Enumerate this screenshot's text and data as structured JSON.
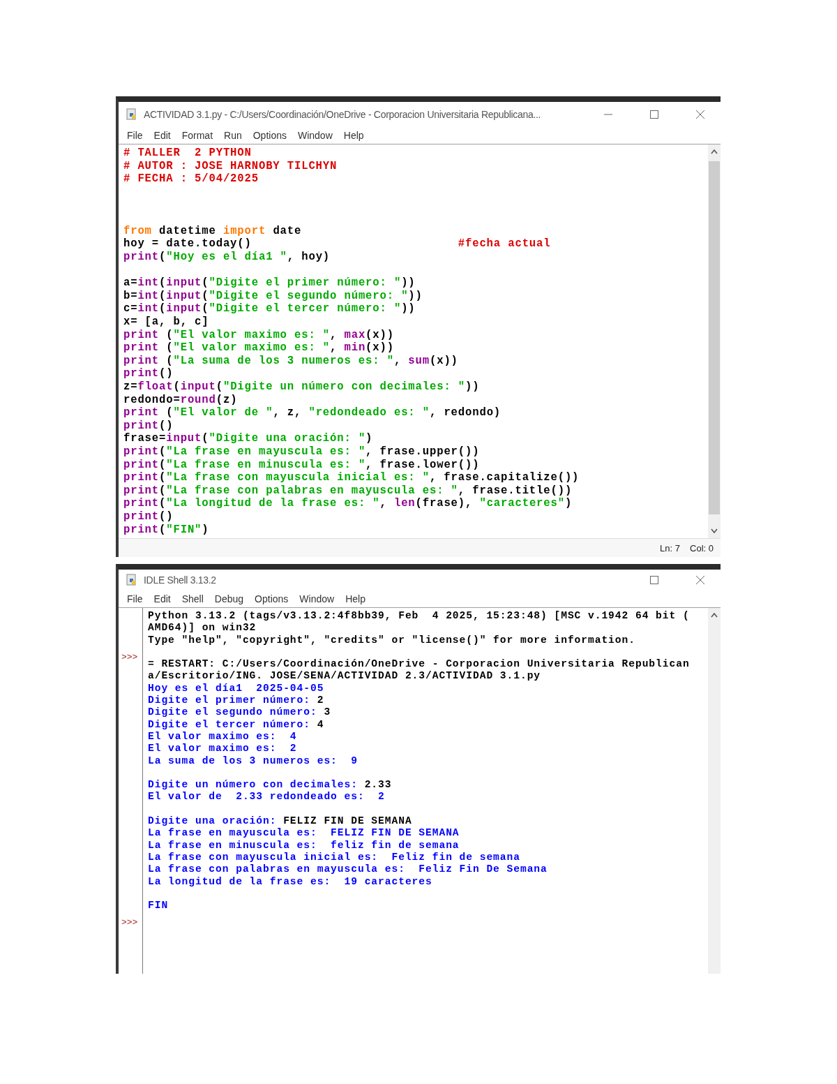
{
  "editor": {
    "title": "ACTIVIDAD 3.1.py - C:/Users/Coordinación/OneDrive - Corporacion Universitaria Republicana...",
    "menu": [
      "File",
      "Edit",
      "Format",
      "Run",
      "Options",
      "Window",
      "Help"
    ],
    "lines": [
      {
        "kind": "code",
        "segments": [
          {
            "text": "# TALLER  2 PYTHON",
            "kind": "comment"
          }
        ]
      },
      {
        "kind": "code",
        "segments": [
          {
            "text": "# AUTOR : JOSE HARNOBY TILCHYN",
            "kind": "comment"
          }
        ]
      },
      {
        "kind": "code",
        "segments": [
          {
            "text": "# FECHA : 5/04/2025",
            "kind": "comment"
          }
        ]
      },
      {
        "kind": "blank"
      },
      {
        "kind": "blank"
      },
      {
        "kind": "blank"
      },
      {
        "kind": "code",
        "segments": [
          {
            "text": "from",
            "kind": "keyword"
          },
          {
            "text": " datetime ",
            "kind": "plain"
          },
          {
            "text": "import",
            "kind": "keyword"
          },
          {
            "text": " date",
            "kind": "plain"
          }
        ]
      },
      {
        "kind": "code",
        "segments": [
          {
            "text": "hoy = date.today()                             ",
            "kind": "plain"
          },
          {
            "text": "#fecha actual",
            "kind": "comment"
          }
        ]
      },
      {
        "kind": "code",
        "segments": [
          {
            "text": "print",
            "kind": "builtin"
          },
          {
            "text": "(",
            "kind": "plain"
          },
          {
            "text": "\"Hoy es el día1 \"",
            "kind": "string"
          },
          {
            "text": ", hoy)",
            "kind": "plain"
          }
        ]
      },
      {
        "kind": "blank"
      },
      {
        "kind": "code",
        "segments": [
          {
            "text": "a=",
            "kind": "plain"
          },
          {
            "text": "int",
            "kind": "builtin"
          },
          {
            "text": "(",
            "kind": "plain"
          },
          {
            "text": "input",
            "kind": "builtin"
          },
          {
            "text": "(",
            "kind": "plain"
          },
          {
            "text": "\"Digite el primer número: \"",
            "kind": "string"
          },
          {
            "text": "))",
            "kind": "plain"
          }
        ]
      },
      {
        "kind": "code",
        "segments": [
          {
            "text": "b=",
            "kind": "plain"
          },
          {
            "text": "int",
            "kind": "builtin"
          },
          {
            "text": "(",
            "kind": "plain"
          },
          {
            "text": "input",
            "kind": "builtin"
          },
          {
            "text": "(",
            "kind": "plain"
          },
          {
            "text": "\"Digite el segundo número: \"",
            "kind": "string"
          },
          {
            "text": "))",
            "kind": "plain"
          }
        ]
      },
      {
        "kind": "code",
        "segments": [
          {
            "text": "c=",
            "kind": "plain"
          },
          {
            "text": "int",
            "kind": "builtin"
          },
          {
            "text": "(",
            "kind": "plain"
          },
          {
            "text": "input",
            "kind": "builtin"
          },
          {
            "text": "(",
            "kind": "plain"
          },
          {
            "text": "\"Digite el tercer número: \"",
            "kind": "string"
          },
          {
            "text": "))",
            "kind": "plain"
          }
        ]
      },
      {
        "kind": "code",
        "segments": [
          {
            "text": "x= [a, b, c]",
            "kind": "plain"
          }
        ]
      },
      {
        "kind": "code",
        "segments": [
          {
            "text": "print",
            "kind": "builtin"
          },
          {
            "text": " (",
            "kind": "plain"
          },
          {
            "text": "\"El valor maximo es: \"",
            "kind": "string"
          },
          {
            "text": ", ",
            "kind": "plain"
          },
          {
            "text": "max",
            "kind": "builtin"
          },
          {
            "text": "(x))",
            "kind": "plain"
          }
        ]
      },
      {
        "kind": "code",
        "segments": [
          {
            "text": "print",
            "kind": "builtin"
          },
          {
            "text": " (",
            "kind": "plain"
          },
          {
            "text": "\"El valor maximo es: \"",
            "kind": "string"
          },
          {
            "text": ", ",
            "kind": "plain"
          },
          {
            "text": "min",
            "kind": "builtin"
          },
          {
            "text": "(x))",
            "kind": "plain"
          }
        ]
      },
      {
        "kind": "code",
        "segments": [
          {
            "text": "print",
            "kind": "builtin"
          },
          {
            "text": " (",
            "kind": "plain"
          },
          {
            "text": "\"La suma de los 3 numeros es: \"",
            "kind": "string"
          },
          {
            "text": ", ",
            "kind": "plain"
          },
          {
            "text": "sum",
            "kind": "builtin"
          },
          {
            "text": "(x))",
            "kind": "plain"
          }
        ]
      },
      {
        "kind": "code",
        "segments": [
          {
            "text": "print",
            "kind": "builtin"
          },
          {
            "text": "()",
            "kind": "plain"
          }
        ]
      },
      {
        "kind": "code",
        "segments": [
          {
            "text": "z=",
            "kind": "plain"
          },
          {
            "text": "float",
            "kind": "builtin"
          },
          {
            "text": "(",
            "kind": "plain"
          },
          {
            "text": "input",
            "kind": "builtin"
          },
          {
            "text": "(",
            "kind": "plain"
          },
          {
            "text": "\"Digite un número con decimales: \"",
            "kind": "string"
          },
          {
            "text": "))",
            "kind": "plain"
          }
        ]
      },
      {
        "kind": "code",
        "segments": [
          {
            "text": "redondo=",
            "kind": "plain"
          },
          {
            "text": "round",
            "kind": "builtin"
          },
          {
            "text": "(z)",
            "kind": "plain"
          }
        ]
      },
      {
        "kind": "code",
        "segments": [
          {
            "text": "print",
            "kind": "builtin"
          },
          {
            "text": " (",
            "kind": "plain"
          },
          {
            "text": "\"El valor de \"",
            "kind": "string"
          },
          {
            "text": ", z, ",
            "kind": "plain"
          },
          {
            "text": "\"redondeado es: \"",
            "kind": "string"
          },
          {
            "text": ", redondo)",
            "kind": "plain"
          }
        ]
      },
      {
        "kind": "code",
        "segments": [
          {
            "text": "print",
            "kind": "builtin"
          },
          {
            "text": "()",
            "kind": "plain"
          }
        ]
      },
      {
        "kind": "code",
        "segments": [
          {
            "text": "frase=",
            "kind": "plain"
          },
          {
            "text": "input",
            "kind": "builtin"
          },
          {
            "text": "(",
            "kind": "plain"
          },
          {
            "text": "\"Digite una oración: \"",
            "kind": "string"
          },
          {
            "text": ")",
            "kind": "plain"
          }
        ]
      },
      {
        "kind": "code",
        "segments": [
          {
            "text": "print",
            "kind": "builtin"
          },
          {
            "text": "(",
            "kind": "plain"
          },
          {
            "text": "\"La frase en mayuscula es: \"",
            "kind": "string"
          },
          {
            "text": ", frase.upper())",
            "kind": "plain"
          }
        ]
      },
      {
        "kind": "code",
        "segments": [
          {
            "text": "print",
            "kind": "builtin"
          },
          {
            "text": "(",
            "kind": "plain"
          },
          {
            "text": "\"La frase en minuscula es: \"",
            "kind": "string"
          },
          {
            "text": ", frase.lower())",
            "kind": "plain"
          }
        ]
      },
      {
        "kind": "code",
        "segments": [
          {
            "text": "print",
            "kind": "builtin"
          },
          {
            "text": "(",
            "kind": "plain"
          },
          {
            "text": "\"La frase con mayuscula inicial es: \"",
            "kind": "string"
          },
          {
            "text": ", frase.capitalize())",
            "kind": "plain"
          }
        ]
      },
      {
        "kind": "code",
        "segments": [
          {
            "text": "print",
            "kind": "builtin"
          },
          {
            "text": "(",
            "kind": "plain"
          },
          {
            "text": "\"La frase con palabras en mayuscula es: \"",
            "kind": "string"
          },
          {
            "text": ", frase.title())",
            "kind": "plain"
          }
        ]
      },
      {
        "kind": "code",
        "segments": [
          {
            "text": "print",
            "kind": "builtin"
          },
          {
            "text": "(",
            "kind": "plain"
          },
          {
            "text": "\"La longitud de la frase es: \"",
            "kind": "string"
          },
          {
            "text": ", ",
            "kind": "plain"
          },
          {
            "text": "len",
            "kind": "builtin"
          },
          {
            "text": "(frase), ",
            "kind": "plain"
          },
          {
            "text": "\"caracteres\"",
            "kind": "string"
          },
          {
            "text": ")",
            "kind": "plain"
          }
        ]
      },
      {
        "kind": "code",
        "segments": [
          {
            "text": "print",
            "kind": "builtin"
          },
          {
            "text": "()",
            "kind": "plain"
          }
        ]
      },
      {
        "kind": "code",
        "segments": [
          {
            "text": "print",
            "kind": "builtin"
          },
          {
            "text": "(",
            "kind": "plain"
          },
          {
            "text": "\"FIN\"",
            "kind": "string"
          },
          {
            "text": ")",
            "kind": "plain"
          }
        ]
      }
    ],
    "status": {
      "line": "Ln: 7",
      "column": "Col: 0"
    }
  },
  "shell": {
    "title": "IDLE Shell 3.13.2",
    "menu": [
      "File",
      "Edit",
      "Shell",
      "Debug",
      "Options",
      "Window",
      "Help"
    ],
    "lines": [
      {
        "kind": "code",
        "segments": [
          {
            "text": "Python 3.13.2 (tags/v3.13.2:4f8bb39, Feb  4 2025, 15:23:48) [MSC v.1942 64 bit (",
            "kind": "plain"
          }
        ]
      },
      {
        "kind": "code",
        "segments": [
          {
            "text": "AMD64)] on win32",
            "kind": "plain"
          }
        ]
      },
      {
        "kind": "code",
        "segments": [
          {
            "text": "Type \"help\", \"copyright\", \"credits\" or \"license()\" for more information.",
            "kind": "plain"
          }
        ]
      },
      {
        "kind": "blank",
        "prompt": ">>>"
      },
      {
        "kind": "code",
        "segments": [
          {
            "text": "= RESTART: C:/Users/Coordinación/OneDrive - Corporacion Universitaria Republican",
            "kind": "plain"
          }
        ]
      },
      {
        "kind": "code",
        "segments": [
          {
            "text": "a/Escritorio/ING. JOSE/SENA/ACTIVIDAD 2.3/ACTIVIDAD 3.1.py",
            "kind": "plain"
          }
        ]
      },
      {
        "kind": "code",
        "segments": [
          {
            "text": "Hoy es el día1  2025-04-05",
            "kind": "output"
          }
        ]
      },
      {
        "kind": "code",
        "segments": [
          {
            "text": "Digite el primer número: ",
            "kind": "output"
          },
          {
            "text": "2",
            "kind": "plain"
          }
        ]
      },
      {
        "kind": "code",
        "segments": [
          {
            "text": "Digite el segundo número: ",
            "kind": "output"
          },
          {
            "text": "3",
            "kind": "plain"
          }
        ]
      },
      {
        "kind": "code",
        "segments": [
          {
            "text": "Digite el tercer número: ",
            "kind": "output"
          },
          {
            "text": "4",
            "kind": "plain"
          }
        ]
      },
      {
        "kind": "code",
        "segments": [
          {
            "text": "El valor maximo es:  4",
            "kind": "output"
          }
        ]
      },
      {
        "kind": "code",
        "segments": [
          {
            "text": "El valor maximo es:  2",
            "kind": "output"
          }
        ]
      },
      {
        "kind": "code",
        "segments": [
          {
            "text": "La suma de los 3 numeros es:  9",
            "kind": "output"
          }
        ]
      },
      {
        "kind": "blank"
      },
      {
        "kind": "code",
        "segments": [
          {
            "text": "Digite un número con decimales: ",
            "kind": "output"
          },
          {
            "text": "2.33",
            "kind": "plain"
          }
        ]
      },
      {
        "kind": "code",
        "segments": [
          {
            "text": "El valor de  2.33 redondeado es:  2",
            "kind": "output"
          }
        ]
      },
      {
        "kind": "blank"
      },
      {
        "kind": "code",
        "segments": [
          {
            "text": "Digite una oración: ",
            "kind": "output"
          },
          {
            "text": "FELIZ FIN DE SEMANA",
            "kind": "plain"
          }
        ]
      },
      {
        "kind": "code",
        "segments": [
          {
            "text": "La frase en mayuscula es:  FELIZ FIN DE SEMANA",
            "kind": "output"
          }
        ]
      },
      {
        "kind": "code",
        "segments": [
          {
            "text": "La frase en minuscula es:  feliz fin de semana",
            "kind": "output"
          }
        ]
      },
      {
        "kind": "code",
        "segments": [
          {
            "text": "La frase con mayuscula inicial es:  Feliz fin de semana",
            "kind": "output"
          }
        ]
      },
      {
        "kind": "code",
        "segments": [
          {
            "text": "La frase con palabras en mayuscula es:  Feliz Fin De Semana",
            "kind": "output"
          }
        ]
      },
      {
        "kind": "code",
        "segments": [
          {
            "text": "La longitud de la frase es:  19 caracteres",
            "kind": "output"
          }
        ]
      },
      {
        "kind": "blank"
      },
      {
        "kind": "code",
        "segments": [
          {
            "text": "FIN",
            "kind": "output"
          }
        ]
      },
      {
        "kind": "blank",
        "prompt": ">>>"
      }
    ]
  }
}
